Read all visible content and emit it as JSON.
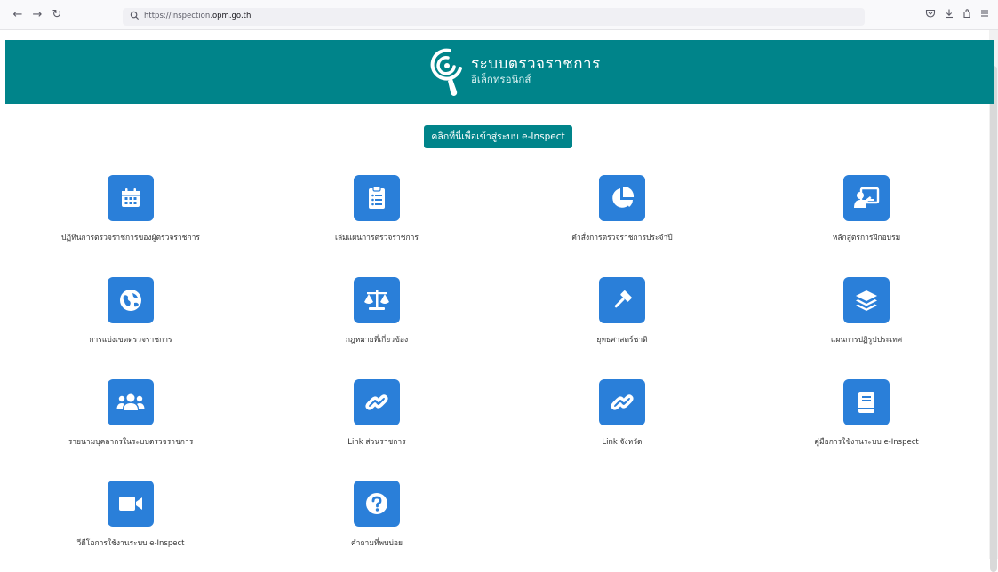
{
  "browser": {
    "url_prefix": "https://inspection.",
    "url_domain": "opm.go.th",
    "icons": [
      "back-icon",
      "forward-icon",
      "reload-icon",
      "lock-icon",
      "pocket-icon",
      "download-icon",
      "extensions-icon",
      "menu-icon"
    ]
  },
  "header": {
    "title": "ระบบตรวจราชการ",
    "subtitle": "อิเล็กทรอนิกส์"
  },
  "cta": {
    "label": "คลิกที่นี่เพื่อเข้าสู่ระบบ e-Inspect"
  },
  "colors": {
    "brand_teal": "#00848a",
    "tile_blue": "#2a7fd9"
  },
  "tiles": [
    {
      "label": "ปฏิทินการตรวจราชการของผู้ตรวจราชการ",
      "icon": "calendar-icon"
    },
    {
      "label": "เล่มแผนการตรวจราชการ",
      "icon": "clipboard-list-icon"
    },
    {
      "label": "คำสั่งการตรวจราชการประจำปี",
      "icon": "pie-chart-icon"
    },
    {
      "label": "หลักสูตรการฝึกอบรม",
      "icon": "presentation-icon"
    },
    {
      "label": "การแบ่งเขตตรวจราชการ",
      "icon": "globe-icon"
    },
    {
      "label": "กฎหมายที่เกี่ยวข้อง",
      "icon": "scale-balance-icon"
    },
    {
      "label": "ยุทธศาสตร์ชาติ",
      "icon": "gavel-icon"
    },
    {
      "label": "แผนการปฏิรูปประเทศ",
      "icon": "layers-icon"
    },
    {
      "label": "รายนามบุคลากรในระบบตรวจราชการ",
      "icon": "users-icon"
    },
    {
      "label": "Link ส่วนราชการ",
      "icon": "link-icon"
    },
    {
      "label": "Link จังหวัด",
      "icon": "link-icon"
    },
    {
      "label": "คู่มือการใช้งานระบบ e-Inspect",
      "icon": "book-icon"
    },
    {
      "label": "วีดีโอการใช้งานระบบ e-Inspect",
      "icon": "video-camera-icon"
    },
    {
      "label": "คำถามที่พบบ่อย",
      "icon": "question-circle-icon"
    }
  ]
}
